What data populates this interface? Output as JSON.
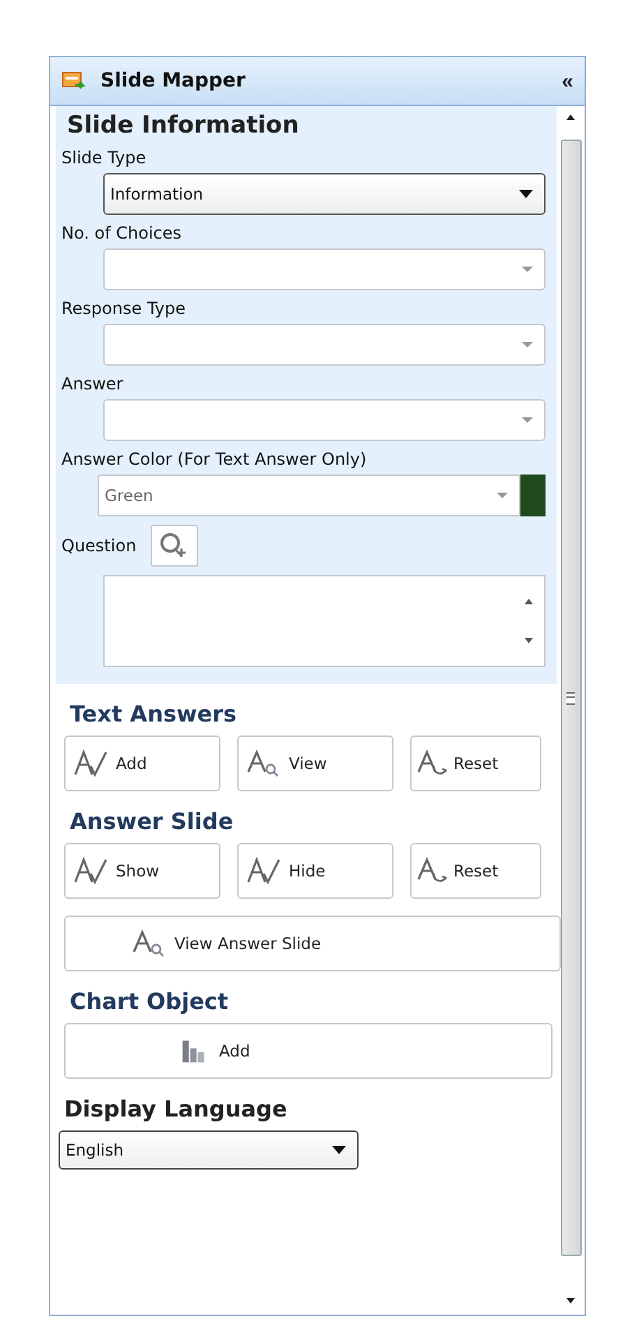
{
  "panel": {
    "title": "Slide Mapper",
    "collapse_glyph": "«"
  },
  "slide_information": {
    "heading": "Slide Information",
    "fields": [
      {
        "kind": "dropdown",
        "label": "Slide Type",
        "value": "Information",
        "focused": true
      },
      {
        "kind": "dropdown",
        "label": "No. of Choices",
        "focused": false
      },
      {
        "kind": "dropdown",
        "label": "Response Type",
        "focused": false
      },
      {
        "kind": "dropdown",
        "label": "Answer",
        "focused": false
      },
      {
        "kind": "color-dropdown",
        "label": "Answer Color (For Text Answer Only)",
        "value": "Green",
        "color": "#1e4a1e",
        "focused": false
      },
      {
        "kind": "question",
        "label": "Question",
        "focused": false
      }
    ]
  },
  "text_answers": {
    "heading": "Text Answers",
    "buttons": [
      {
        "label": "Add",
        "kind": "check"
      },
      {
        "label": "View",
        "kind": "magnifier"
      },
      {
        "label": "Reset",
        "kind": "reset"
      }
    ]
  },
  "answer_slide": {
    "heading": "Answer Slide",
    "buttons": [
      {
        "label": "Show",
        "kind": "check"
      },
      {
        "label": "Hide",
        "kind": "check"
      },
      {
        "label": "Reset",
        "kind": "reset"
      }
    ],
    "wide_button": {
      "label": "View Answer Slide",
      "kind": "magnifier"
    }
  },
  "chart_object": {
    "heading": "Chart Object",
    "button": {
      "label": "Add",
      "kind": "chart"
    }
  },
  "display_language": {
    "heading": "Display Language",
    "value": "English"
  }
}
